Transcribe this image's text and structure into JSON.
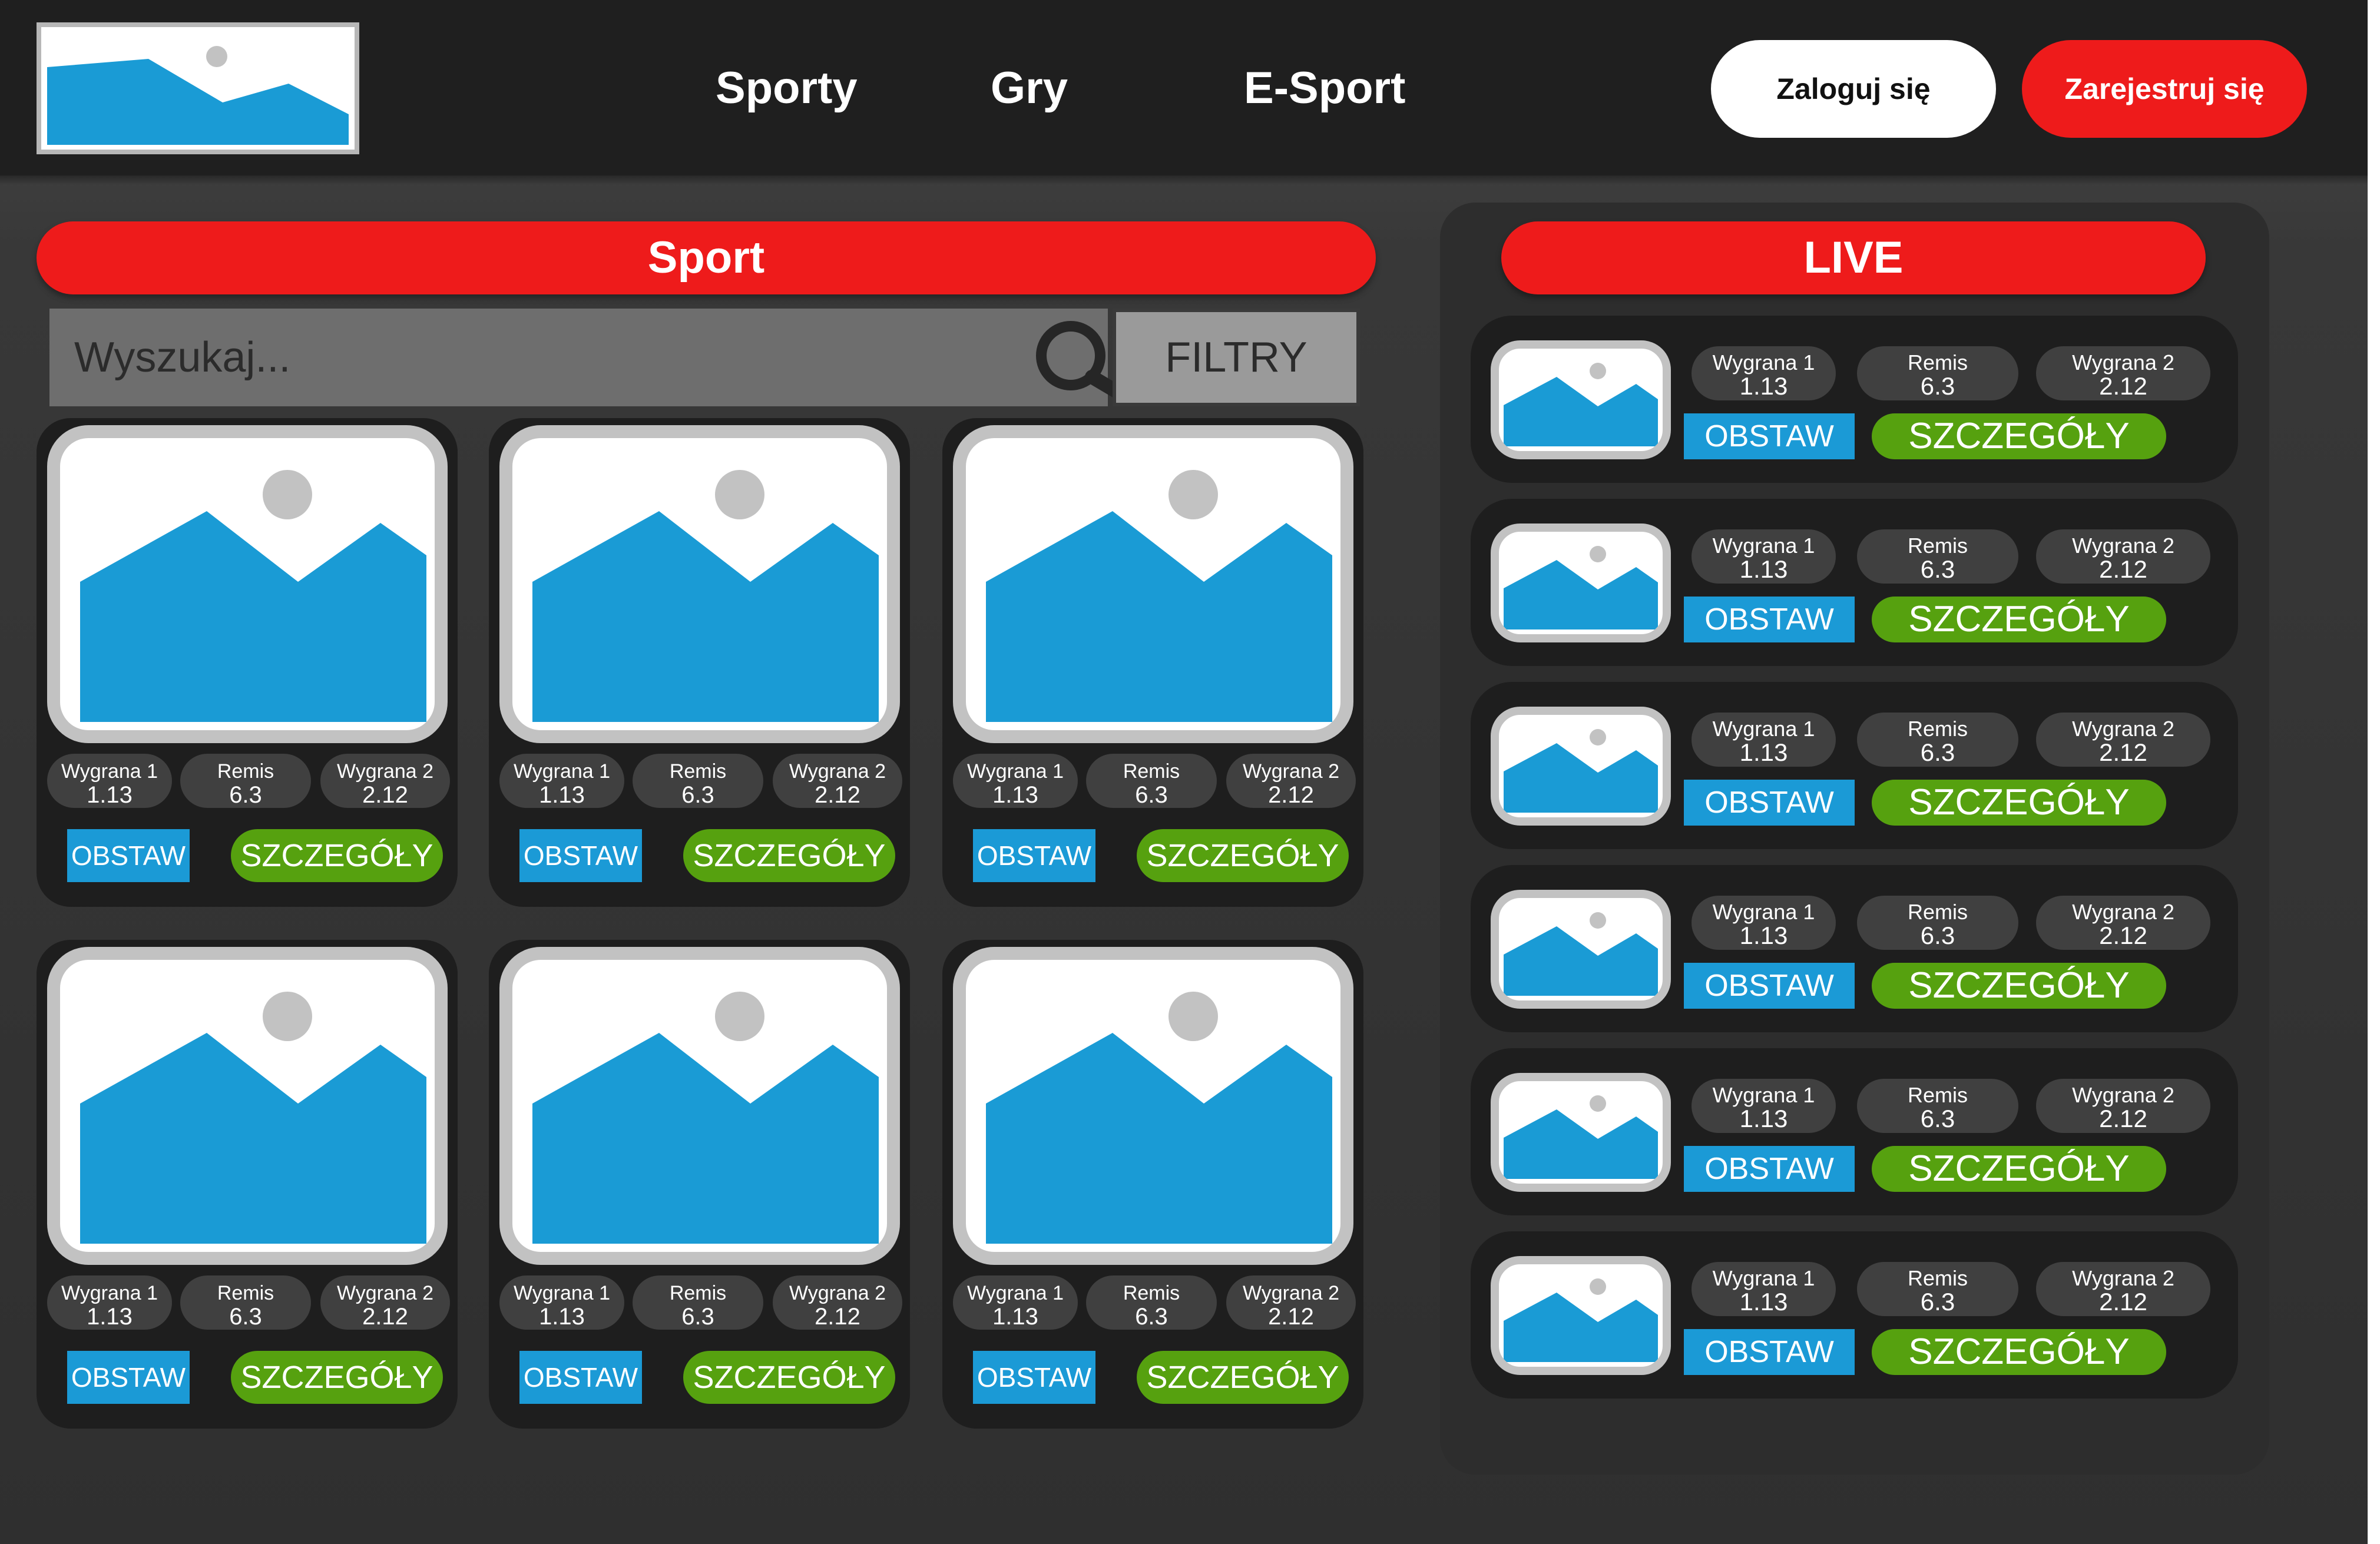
{
  "header": {
    "logo_icon": "image-placeholder-icon",
    "nav": [
      {
        "label": "Sporty"
      },
      {
        "label": "Gry"
      },
      {
        "label": "E-Sport"
      }
    ],
    "login_label": "Zaloguj się",
    "register_label": "Zarejestruj się"
  },
  "sport": {
    "title": "Sport",
    "search": {
      "placeholder": "Wyszukaj...",
      "icon": "search-icon"
    },
    "filter_label": "FILTRY",
    "cards": [
      {
        "odds": [
          {
            "label": "Wygrana 1",
            "value": "1.13"
          },
          {
            "label": "Remis",
            "value": "6.3"
          },
          {
            "label": "Wygrana 2",
            "value": "2.12"
          }
        ],
        "bet_label": "OBSTAW",
        "details_label": "SZCZEGÓŁY"
      },
      {
        "odds": [
          {
            "label": "Wygrana 1",
            "value": "1.13"
          },
          {
            "label": "Remis",
            "value": "6.3"
          },
          {
            "label": "Wygrana 2",
            "value": "2.12"
          }
        ],
        "bet_label": "OBSTAW",
        "details_label": "SZCZEGÓŁY"
      },
      {
        "odds": [
          {
            "label": "Wygrana 1",
            "value": "1.13"
          },
          {
            "label": "Remis",
            "value": "6.3"
          },
          {
            "label": "Wygrana 2",
            "value": "2.12"
          }
        ],
        "bet_label": "OBSTAW",
        "details_label": "SZCZEGÓŁY"
      },
      {
        "odds": [
          {
            "label": "Wygrana 1",
            "value": "1.13"
          },
          {
            "label": "Remis",
            "value": "6.3"
          },
          {
            "label": "Wygrana 2",
            "value": "2.12"
          }
        ],
        "bet_label": "OBSTAW",
        "details_label": "SZCZEGÓŁY"
      },
      {
        "odds": [
          {
            "label": "Wygrana 1",
            "value": "1.13"
          },
          {
            "label": "Remis",
            "value": "6.3"
          },
          {
            "label": "Wygrana 2",
            "value": "2.12"
          }
        ],
        "bet_label": "OBSTAW",
        "details_label": "SZCZEGÓŁY"
      },
      {
        "odds": [
          {
            "label": "Wygrana 1",
            "value": "1.13"
          },
          {
            "label": "Remis",
            "value": "6.3"
          },
          {
            "label": "Wygrana 2",
            "value": "2.12"
          }
        ],
        "bet_label": "OBSTAW",
        "details_label": "SZCZEGÓŁY"
      }
    ]
  },
  "live": {
    "title": "LIVE",
    "rows": [
      {
        "odds": [
          {
            "label": "Wygrana 1",
            "value": "1.13"
          },
          {
            "label": "Remis",
            "value": "6.3"
          },
          {
            "label": "Wygrana 2",
            "value": "2.12"
          }
        ],
        "bet_label": "OBSTAW",
        "details_label": "SZCZEGÓŁY"
      },
      {
        "odds": [
          {
            "label": "Wygrana 1",
            "value": "1.13"
          },
          {
            "label": "Remis",
            "value": "6.3"
          },
          {
            "label": "Wygrana 2",
            "value": "2.12"
          }
        ],
        "bet_label": "OBSTAW",
        "details_label": "SZCZEGÓŁY"
      },
      {
        "odds": [
          {
            "label": "Wygrana 1",
            "value": "1.13"
          },
          {
            "label": "Remis",
            "value": "6.3"
          },
          {
            "label": "Wygrana 2",
            "value": "2.12"
          }
        ],
        "bet_label": "OBSTAW",
        "details_label": "SZCZEGÓŁY"
      },
      {
        "odds": [
          {
            "label": "Wygrana 1",
            "value": "1.13"
          },
          {
            "label": "Remis",
            "value": "6.3"
          },
          {
            "label": "Wygrana 2",
            "value": "2.12"
          }
        ],
        "bet_label": "OBSTAW",
        "details_label": "SZCZEGÓŁY"
      },
      {
        "odds": [
          {
            "label": "Wygrana 1",
            "value": "1.13"
          },
          {
            "label": "Remis",
            "value": "6.3"
          },
          {
            "label": "Wygrana 2",
            "value": "2.12"
          }
        ],
        "bet_label": "OBSTAW",
        "details_label": "SZCZEGÓŁY"
      },
      {
        "odds": [
          {
            "label": "Wygrana 1",
            "value": "1.13"
          },
          {
            "label": "Remis",
            "value": "6.3"
          },
          {
            "label": "Wygrana 2",
            "value": "2.12"
          }
        ],
        "bet_label": "OBSTAW",
        "details_label": "SZCZEGÓŁY"
      }
    ]
  },
  "colors": {
    "header_bg": "#1f1f1f",
    "accent_red": "#ee1b1b",
    "bet_blue": "#1b9ad6",
    "details_green": "#56a10f",
    "placeholder_blue": "#1a9bd5",
    "placeholder_sun": "#c2c2c2"
  }
}
